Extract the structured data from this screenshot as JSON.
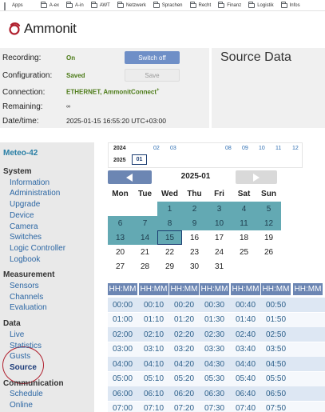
{
  "bookmarks": [
    {
      "label": "Apps",
      "icon": "apps-grid-icon"
    },
    {
      "label": "A-ex",
      "icon": "folder-icon"
    },
    {
      "label": "A-in",
      "icon": "folder-icon"
    },
    {
      "label": "AWT",
      "icon": "folder-icon"
    },
    {
      "label": "Netzwerk",
      "icon": "folder-icon"
    },
    {
      "label": "Sprachen",
      "icon": "folder-icon"
    },
    {
      "label": "Recht",
      "icon": "folder-icon"
    },
    {
      "label": "Finanz",
      "icon": "folder-icon"
    },
    {
      "label": "Logistik",
      "icon": "folder-icon"
    },
    {
      "label": "Infos",
      "icon": "folder-icon"
    }
  ],
  "logo": {
    "text": "Ammonit",
    "color": "#b0202e"
  },
  "status": {
    "recording_label": "Recording:",
    "recording_value": "On",
    "switch_off_label": "Switch off",
    "configuration_label": "Configuration:",
    "configuration_value": "Saved",
    "save_label": "Save",
    "connection_label": "Connection:",
    "connection_value": "ETHERNET, AmmonitConnect",
    "connection_sup": "+",
    "remaining_label": "Remaining:",
    "remaining_value": "∞",
    "datetime_label": "Date/time:",
    "datetime_value": "2025-01-15 16:55:20 UTC+03:00"
  },
  "page_title": "Source Data",
  "sidebar": {
    "device_name": "Meteo-42",
    "sections": [
      {
        "title": "System",
        "items": [
          "Information",
          "Administration",
          "Upgrade",
          "Device",
          "Camera",
          "Switches",
          "Logic Controller",
          "Logbook"
        ]
      },
      {
        "title": "Measurement",
        "items": [
          "Sensors",
          "Channels",
          "Evaluation"
        ]
      },
      {
        "title": "Data",
        "items": [
          "Live",
          "Statistics",
          "Gusts",
          "Source"
        ]
      },
      {
        "title": "Communication",
        "items": [
          "Schedule",
          "Online"
        ]
      }
    ],
    "active_item": "Source"
  },
  "year_selector": {
    "years": [
      "2024",
      "2025"
    ],
    "months_2024": [
      "02",
      "03",
      "08",
      "09",
      "10",
      "11",
      "12"
    ],
    "months_2025": [
      "01"
    ],
    "selected_month": "01"
  },
  "calendar": {
    "title": "2025-01",
    "weekdays": [
      "Mon",
      "Tue",
      "Wed",
      "Thu",
      "Fri",
      "Sat",
      "Sun"
    ],
    "first_weekday_index": 2,
    "days_in_month": 31,
    "days_with_data_through": 15,
    "selected_day": 15
  },
  "times": {
    "header": "HH:MM",
    "columns": 7,
    "values": [
      "00:00",
      "00:10",
      "00:20",
      "00:30",
      "00:40",
      "00:50",
      "01:00",
      "01:10",
      "01:20",
      "01:30",
      "01:40",
      "01:50",
      "02:00",
      "02:10",
      "02:20",
      "02:30",
      "02:40",
      "02:50",
      "03:00",
      "03:10",
      "03:20",
      "03:30",
      "03:40",
      "03:50",
      "04:00",
      "04:10",
      "04:20",
      "04:30",
      "04:40",
      "04:50",
      "05:00",
      "05:10",
      "05:20",
      "05:30",
      "05:40",
      "05:50",
      "06:00",
      "06:10",
      "06:20",
      "06:30",
      "06:40",
      "06:50",
      "07:00",
      "07:10",
      "07:20",
      "07:30",
      "07:40",
      "07:50"
    ]
  }
}
